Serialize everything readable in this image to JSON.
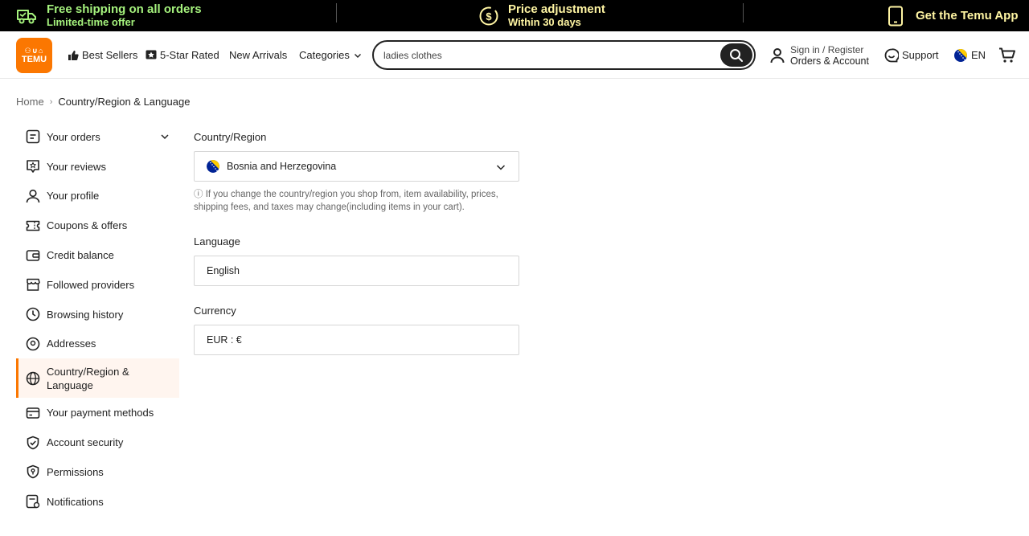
{
  "promo": {
    "shipping_title": "Free shipping on all orders",
    "shipping_sub": "Limited-time offer",
    "price_title": "Price adjustment",
    "price_sub": "Within 30 days",
    "app_label": "Get the Temu App"
  },
  "header": {
    "logo_symbols": "⚇∪⌂",
    "logo_text": "TEMU",
    "nav": {
      "best_sellers": "Best Sellers",
      "five_star": "5-Star Rated",
      "new_arrivals": "New Arrivals",
      "categories": "Categories"
    },
    "search_value": "ladies clothes",
    "account_line1": "Sign in / Register",
    "account_line2": "Orders & Account",
    "support": "Support",
    "language": "EN"
  },
  "breadcrumb": {
    "home": "Home",
    "current": "Country/Region & Language"
  },
  "sidebar": {
    "items": [
      {
        "label": "Your orders"
      },
      {
        "label": "Your reviews"
      },
      {
        "label": "Your profile"
      },
      {
        "label": "Coupons & offers"
      },
      {
        "label": "Credit balance"
      },
      {
        "label": "Followed providers"
      },
      {
        "label": "Browsing history"
      },
      {
        "label": "Addresses"
      },
      {
        "label": "Country/Region & Language"
      },
      {
        "label": "Your payment methods"
      },
      {
        "label": "Account security"
      },
      {
        "label": "Permissions"
      },
      {
        "label": "Notifications"
      }
    ],
    "active_index": 8
  },
  "form": {
    "country_label": "Country/Region",
    "country_value": "Bosnia and Herzegovina",
    "country_note": "ⓘ If you change the country/region you shop from, item availability, prices, shipping fees, and taxes may change(including items in your cart).",
    "language_label": "Language",
    "language_value": "English",
    "currency_label": "Currency",
    "currency_value": "EUR : €"
  },
  "colors": {
    "brand": "#fb7701",
    "promo_green": "#a5f27d",
    "promo_yellow": "#fff5a3",
    "active_bg": "#fff5ef"
  }
}
